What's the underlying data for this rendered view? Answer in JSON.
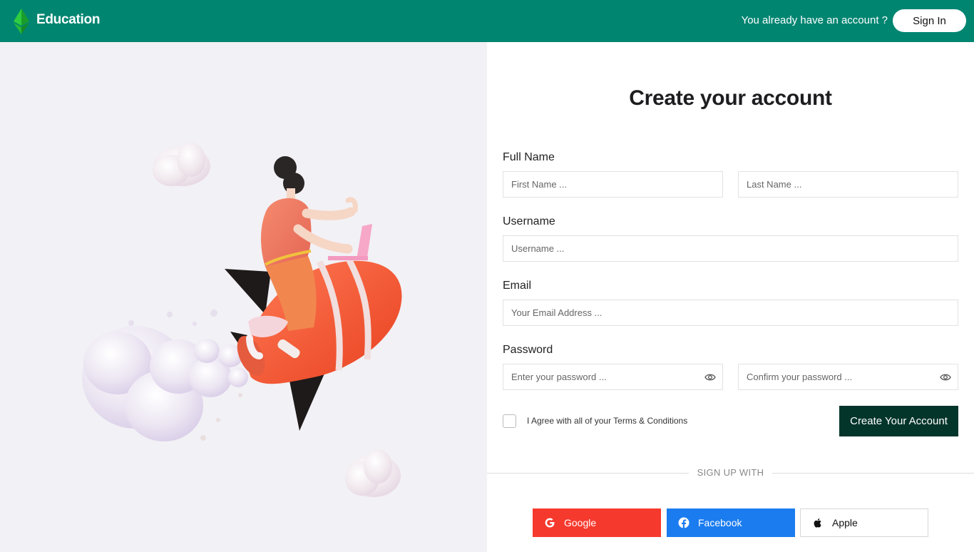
{
  "header": {
    "brand": "Education",
    "have_account": "You already have an account ?",
    "signin_label": "Sign In"
  },
  "form": {
    "title": "Create your account",
    "full_name_label": "Full Name",
    "first_name_placeholder": "First Name ...",
    "last_name_placeholder": "Last Name ...",
    "username_label": "Username",
    "username_placeholder": "Username ...",
    "email_label": "Email",
    "email_placeholder": "Your Email Address ...",
    "password_label": "Password",
    "password_placeholder": "Enter your password ...",
    "confirm_password_placeholder": "Confirm your password ...",
    "agree_text": "I Agree with all of your Terms & Conditions",
    "submit_label": "Create Your Account"
  },
  "signup_with": {
    "label": "SIGN UP WITH",
    "google": "Google",
    "facebook": "Facebook",
    "apple": "Apple"
  },
  "colors": {
    "header_bg": "#008571",
    "submit_bg": "#04352b",
    "google_bg": "#f6392d",
    "facebook_bg": "#1b7cf0",
    "illustration_bg": "#f2f1f5"
  },
  "icons": [
    "emerald-logo-icon",
    "eye-icon",
    "google-icon",
    "facebook-icon",
    "apple-icon"
  ]
}
